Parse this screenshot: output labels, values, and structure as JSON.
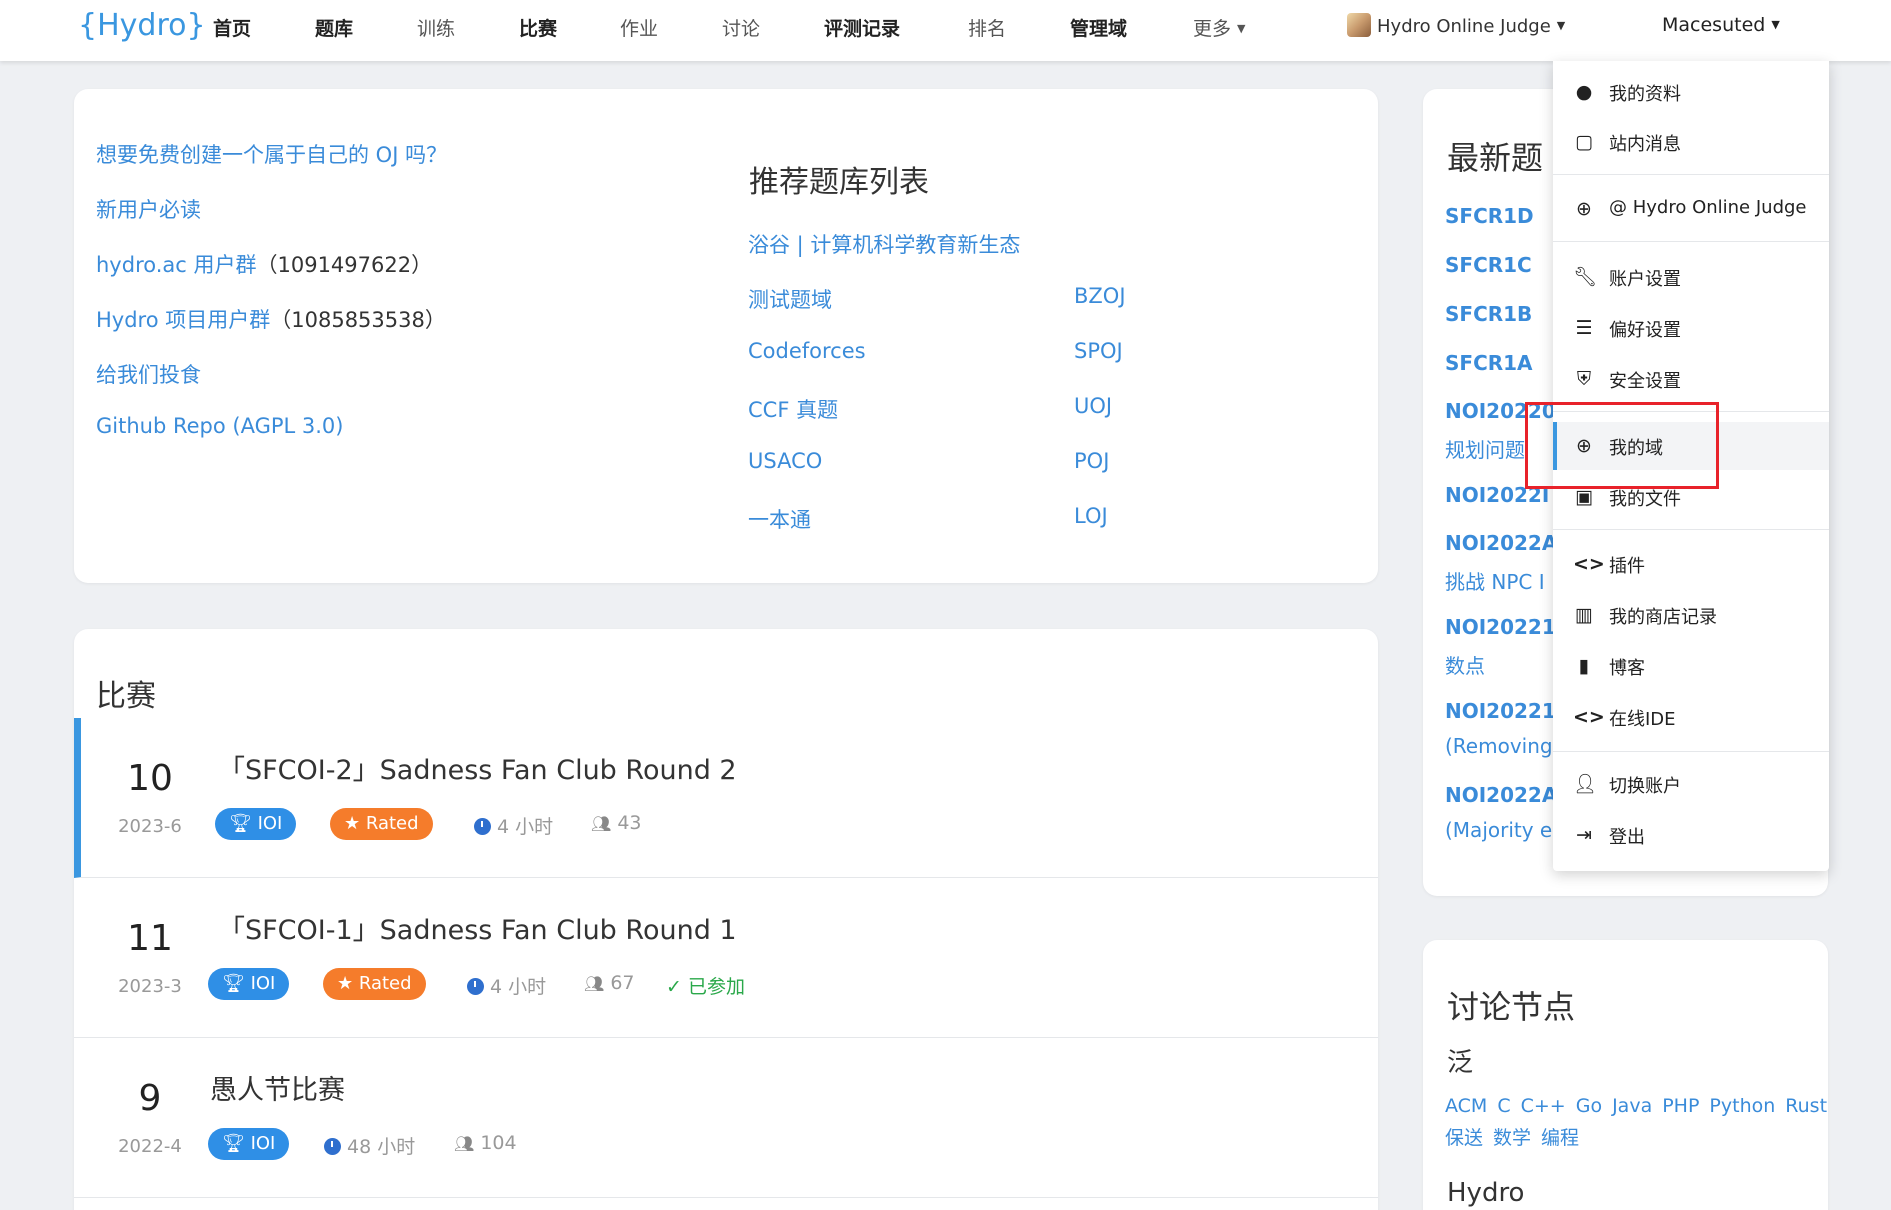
{
  "nav": {
    "logo": "{Hydro}",
    "items": [
      "首页",
      "题库",
      "训练",
      "比赛",
      "作业",
      "讨论",
      "评测记录",
      "排名",
      "管理域",
      "更多"
    ],
    "domain": "Hydro Online Judge",
    "user": "Macesuted"
  },
  "links_card": {
    "left_links": [
      {
        "text": "想要免费创建一个属于自己的 OJ 吗？",
        "extra": ""
      },
      {
        "text": "新用户必读",
        "extra": ""
      },
      {
        "text": "hydro.ac 用户群",
        "extra": "（1091497622）"
      },
      {
        "text": "Hydro 项目用户群",
        "extra": "（1085853538）"
      },
      {
        "text": "给我们投食",
        "extra": ""
      },
      {
        "text": "Github Repo (AGPL 3.0)",
        "extra": ""
      }
    ],
    "rec_title": "推荐题库列表",
    "rec_top": "浴谷 | 计算机科学教育新生态",
    "rec_col1": [
      "测试题域",
      "Codeforces",
      "CCF 真题",
      "USACO",
      "一本通"
    ],
    "rec_col2": [
      "BZOJ",
      "SPOJ",
      "UOJ",
      "POJ",
      "LOJ"
    ]
  },
  "contests": {
    "title": "比赛",
    "rows": [
      {
        "day": "10",
        "month": "2023-6",
        "title": "「SFCOI-2」Sadness Fan Club Round 2",
        "rule": "IOI",
        "rated": "Rated",
        "duration": "4 小时",
        "participants": "43",
        "joined": ""
      },
      {
        "day": "11",
        "month": "2023-3",
        "title": "「SFCOI-1」Sadness Fan Club Round 1",
        "rule": "IOI",
        "rated": "Rated",
        "duration": "4 小时",
        "participants": "67",
        "joined": "已参加"
      },
      {
        "day": "9",
        "month": "2022-4",
        "title": "愚人节比赛",
        "rule": "IOI",
        "rated": "",
        "duration": "48 小时",
        "participants": "104",
        "joined": ""
      }
    ]
  },
  "latest": {
    "title": "最新题",
    "problems": [
      "SFCR1D",
      "SFCR1C",
      "SFCR1B",
      "SFCR1A",
      "NOI20220",
      "NOI2022I",
      "NOI2022A",
      "NOI20221",
      "NOI20221",
      "NOI2022A"
    ],
    "subs": [
      "规划问题",
      "挑战 NPC I",
      "数点",
      "(Removing",
      "(Majority e"
    ]
  },
  "nodes": {
    "title": "讨论节点",
    "cat1": "泛",
    "tags": [
      "ACM",
      "C",
      "C++",
      "Go",
      "Java",
      "PHP",
      "Python",
      "Rust",
      "保送",
      "数学",
      "编程"
    ],
    "cat2": "Hydro"
  },
  "dropdown": {
    "items": [
      {
        "icon": "user-circle-icon",
        "label": "我的资料"
      },
      {
        "icon": "message-icon",
        "label": "站内消息"
      },
      {
        "icon": "globe-icon",
        "label": "@ Hydro Online Judge"
      },
      {
        "icon": "wrench-icon",
        "label": "账户设置"
      },
      {
        "icon": "sliders-icon",
        "label": "偏好设置"
      },
      {
        "icon": "shield-icon",
        "label": "安全设置"
      },
      {
        "icon": "globe-icon",
        "label": "我的域"
      },
      {
        "icon": "image-file-icon",
        "label": "我的文件"
      },
      {
        "icon": "code-icon",
        "label": "插件"
      },
      {
        "icon": "bar-chart-icon",
        "label": "我的商店记录"
      },
      {
        "icon": "book-icon",
        "label": "博客"
      },
      {
        "icon": "code-icon",
        "label": "在线IDE"
      },
      {
        "icon": "user-icon",
        "label": "切换账户"
      },
      {
        "icon": "logout-icon",
        "label": "登出"
      }
    ]
  }
}
